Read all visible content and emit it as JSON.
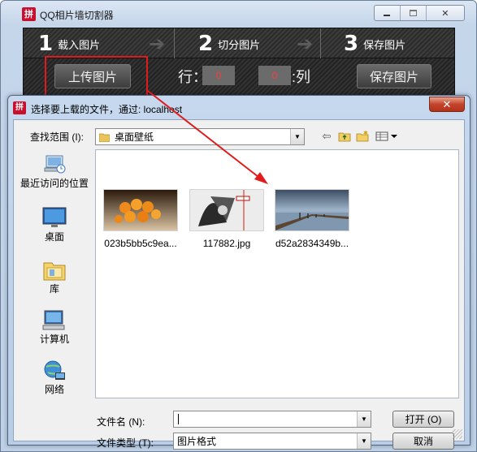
{
  "app": {
    "title": "QQ相片墙切割器",
    "logo_char": "拼",
    "steps": [
      {
        "num": "1",
        "label": "载入图片"
      },
      {
        "num": "2",
        "label": "切分图片"
      },
      {
        "num": "3",
        "label": "保存图片"
      }
    ],
    "toolbar": {
      "upload_label": "上传图片",
      "rows_label": "行：",
      "rows_value": "0",
      "cols_value": "0",
      "cols_label": ":列",
      "save_label": "保存图片"
    }
  },
  "dialog": {
    "logo_char": "拼",
    "title": "选择要上载的文件，通过: localhost",
    "close_glyph": "✕",
    "look_in_label": "查找范围 (I):",
    "look_in_value": "桌面壁纸",
    "places": [
      {
        "label": "最近访问的位置",
        "icon": "recent-places-icon"
      },
      {
        "label": "桌面",
        "icon": "desktop-icon"
      },
      {
        "label": "库",
        "icon": "library-icon"
      },
      {
        "label": "计算机",
        "icon": "computer-icon"
      },
      {
        "label": "网络",
        "icon": "network-icon"
      }
    ],
    "files": [
      {
        "name": "023b5bb5c9ea..."
      },
      {
        "name": "117882.jpg"
      },
      {
        "name": "d52a2834349b..."
      }
    ],
    "filename_label": "文件名 (N):",
    "filename_value": "",
    "filetype_label": "文件类型 (T):",
    "filetype_value": "图片格式",
    "open_label": "打开 (O)",
    "cancel_label": "取消"
  },
  "colors": {
    "annotation_red": "#e11b1b",
    "logo_red": "#c8102e",
    "counter_red": "#ff3b3b"
  }
}
